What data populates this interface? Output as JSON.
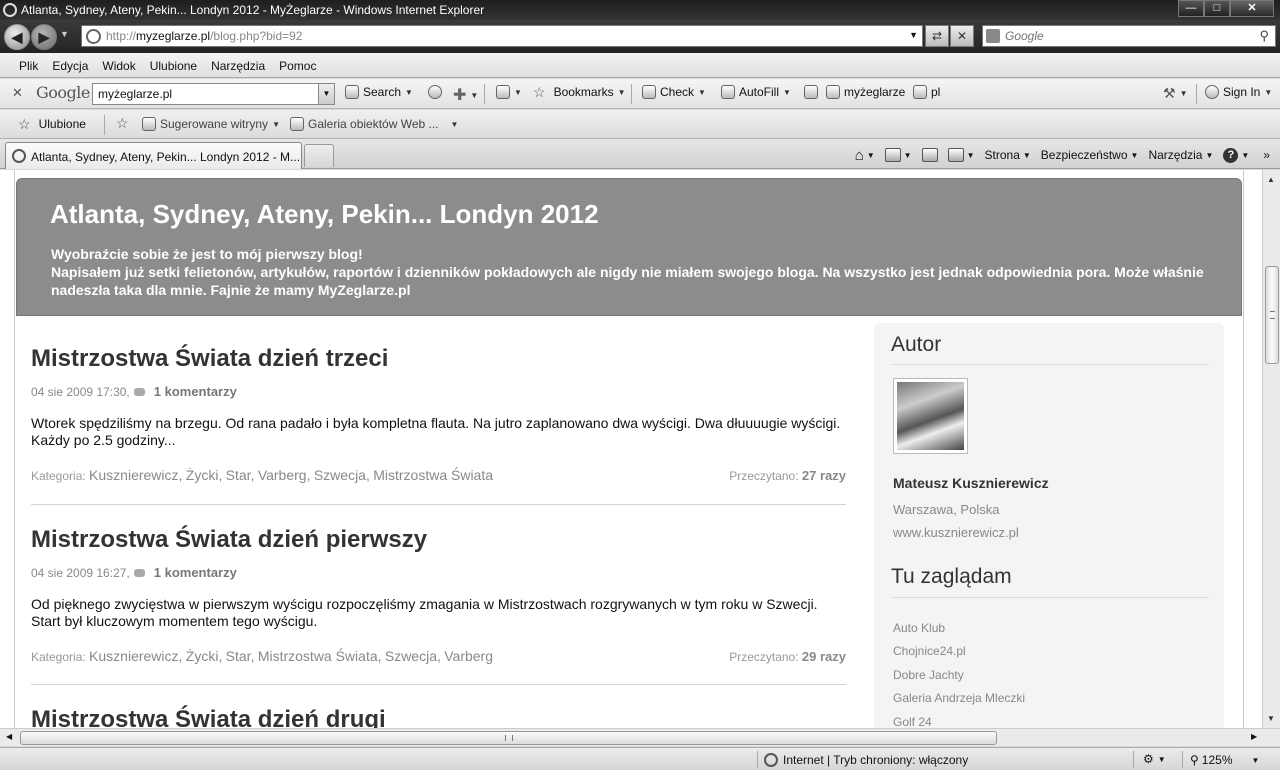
{
  "window": {
    "title": "Atlanta, Sydney, Ateny, Pekin... Londyn 2012 - MyŻeglarze - Windows Internet Explorer",
    "min_glyph": "—",
    "max_glyph": "□",
    "close_glyph": "✕"
  },
  "address": {
    "url_prefix": "http://",
    "url_host": "myzeglarze.pl",
    "url_path": "/blog.php?bid=92"
  },
  "search": {
    "placeholder": "Google"
  },
  "menu": [
    {
      "label": "Plik"
    },
    {
      "label": "Edycja"
    },
    {
      "label": "Widok"
    },
    {
      "label": "Ulubione"
    },
    {
      "label": "Narzędzia"
    },
    {
      "label": "Pomoc"
    }
  ],
  "google_toolbar": {
    "logo": "Google",
    "query": "myżeglarze.pl",
    "search_label": "Search",
    "bookmarks_label": "Bookmarks",
    "check_label": "Check",
    "autofill_label": "AutoFill",
    "highlight1_label": "myżeglarze",
    "highlight2_label": "pl",
    "signin_label": "Sign In"
  },
  "favorites_bar": {
    "favorites_label": "Ulubione",
    "suggested_label": "Sugerowane witryny",
    "gallery_label": "Galeria obiektów Web ..."
  },
  "tab": {
    "label": "Atlanta, Sydney, Ateny, Pekin... Londyn 2012 - M..."
  },
  "command_bar": {
    "page_label": "Strona",
    "safety_label": "Bezpieczeństwo",
    "tools_label": "Narzędzia",
    "help_glyph": "?"
  },
  "blog": {
    "title": "Atlanta, Sydney, Ateny, Pekin... Londyn 2012",
    "description_line1": "Wyobraźcie sobie że jest to mój pierwszy blog!",
    "description_line2": "Napisałem już setki felietonów, artykułów, raportów i dzienników pokładowych ale nigdy nie miałem swojego bloga. Na wszystko jest jednak odpowiednia pora. Może właśnie nadeszła taka dla mnie. Fajnie że mamy MyZeglarze.pl"
  },
  "posts": [
    {
      "title": "Mistrzostwa Świata dzień trzeci",
      "date": "04 sie 2009 17:30,",
      "comments": "1 komentarzy",
      "excerpt": "Wtorek spędziliśmy na brzegu. Od rana padało i była kompletna flauta. Na jutro zaplanowano dwa wyścigi. Dwa dłuuuugie wyścigi. Każdy po 2.5 godziny...",
      "category_label": "Kategoria:",
      "categories": [
        "Kusznierewicz",
        "Życki",
        "Star",
        "Varberg",
        "Szwecja",
        "Mistrzostwa Świata"
      ],
      "reads_label": "Przeczytano:",
      "reads_value": "27 razy"
    },
    {
      "title": "Mistrzostwa Świata dzień pierwszy",
      "date": "04 sie 2009 16:27,",
      "comments": "1 komentarzy",
      "excerpt": "Od pięknego zwycięstwa w pierwszym wyścigu rozpoczęliśmy zmagania w Mistrzostwach rozgrywanych w tym roku w Szwecji. Start był kluczowym momentem tego wyścigu.",
      "category_label": "Kategoria:",
      "categories": [
        "Kusznierewicz",
        "Życki",
        "Star",
        "Mistrzostwa Świata",
        "Szwecja",
        "Varberg"
      ],
      "reads_label": "Przeczytano:",
      "reads_value": "29 razy"
    },
    {
      "title": "Mistrzostwa Świata dzień drugi"
    }
  ],
  "sidebar": {
    "author_heading": "Autor",
    "author_name": "Mateusz Kusznierewicz",
    "author_location": "Warszawa, Polska",
    "author_site": "www.kusznierewicz.pl",
    "links_heading": "Tu zaglądam",
    "links": [
      "Auto Klub",
      "Chojnice24.pl",
      "Dobre Jachty",
      "Galeria Andrzeja Mleczki",
      "Golf 24"
    ]
  },
  "status": {
    "zone": "Internet | Tryb chroniony: włączony",
    "zoom": "125%"
  },
  "icons": [
    "ie-logo",
    "back-icon",
    "forward-icon",
    "page-icon",
    "refresh-icon",
    "stop-icon",
    "search-icon",
    "star-icon",
    "home-icon",
    "rss-icon",
    "mail-icon",
    "print-icon",
    "help-icon",
    "globe-icon",
    "comment-icon",
    "zoom-icon"
  ]
}
